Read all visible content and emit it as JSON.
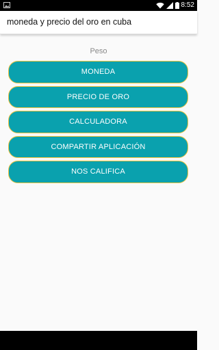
{
  "status_bar": {
    "time": "8:52",
    "icons": [
      "image-icon",
      "wifi-icon",
      "signal-icon",
      "battery-icon"
    ]
  },
  "app_bar": {
    "title": "moneda y precio del oro en cuba"
  },
  "main": {
    "subtitle": "Peso",
    "buttons": [
      {
        "label": "MONEDA"
      },
      {
        "label": "PRECIO DE ORO"
      },
      {
        "label": "CALCULADORA"
      },
      {
        "label": "COMPARTIR APLICACIÓN"
      },
      {
        "label": "NOS CALIFICA"
      }
    ]
  },
  "colors": {
    "button_fill": "#0aa1ae",
    "button_border": "#f0c33c",
    "app_bar": "#ffffff",
    "status_bar": "#000000"
  }
}
